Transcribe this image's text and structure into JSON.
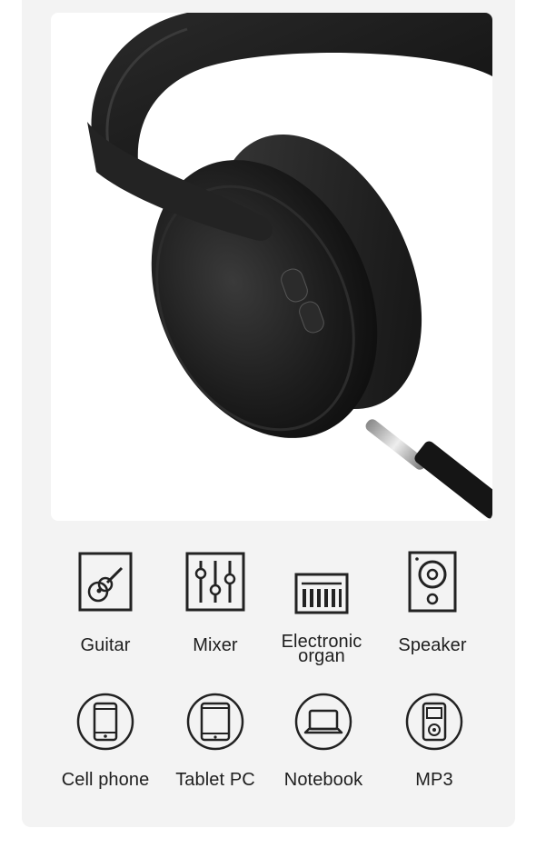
{
  "product_image": {
    "icon": "headphones-with-aux-cable-photo"
  },
  "devices_row1": [
    {
      "label": "Guitar",
      "icon": "guitar-icon"
    },
    {
      "label": "Mixer",
      "icon": "mixer-icon"
    },
    {
      "label_line1": "Electronic",
      "label_line2": "organ",
      "icon": "keyboard-icon"
    },
    {
      "label": "Speaker",
      "icon": "speaker-icon"
    }
  ],
  "devices_row2": [
    {
      "label": "Cell phone",
      "icon": "phone-icon"
    },
    {
      "label": "Tablet PC",
      "icon": "tablet-icon"
    },
    {
      "label": "Notebook",
      "icon": "laptop-icon"
    },
    {
      "label": "MP3",
      "icon": "mp3-player-icon"
    }
  ],
  "headphone_buttons": {
    "button1_text": "⏮/⏯",
    "button2_text": "+/–"
  }
}
